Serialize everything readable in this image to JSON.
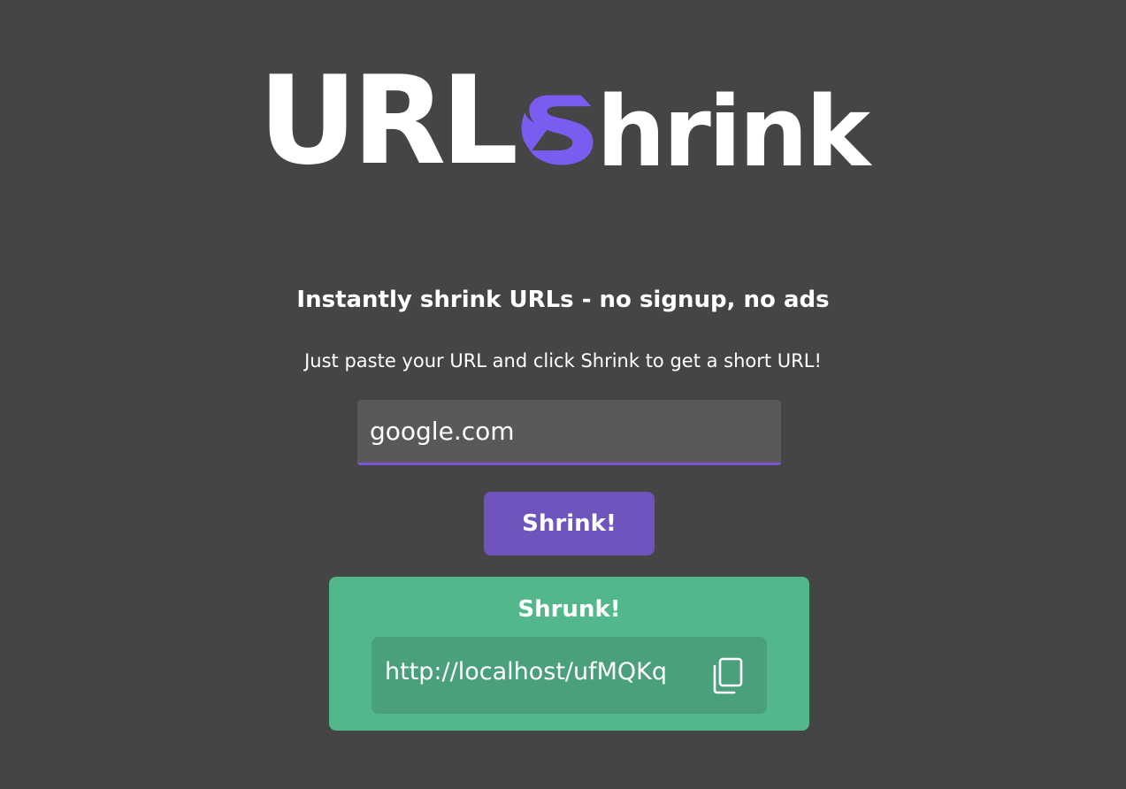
{
  "logo": {
    "text_url": "URL",
    "text_hrink": "hrink",
    "icon": "stylized-s-icon",
    "accent_color": "#7b5cf0"
  },
  "headline": "Instantly shrink URLs - no signup, no ads",
  "subline": "Just paste your URL and click Shrink to get a short URL!",
  "input": {
    "value": "google.com"
  },
  "shrink_button": {
    "label": "Shrink!"
  },
  "result": {
    "title": "Shrunk!",
    "short_url": "http://localhost/ufMQKq",
    "copy_icon": "copy-icon"
  },
  "colors": {
    "background": "#454545",
    "button": "#6f54be",
    "result_card": "#52b78a",
    "result_box": "#4aa07a",
    "input_underline": "#7a56d6"
  }
}
